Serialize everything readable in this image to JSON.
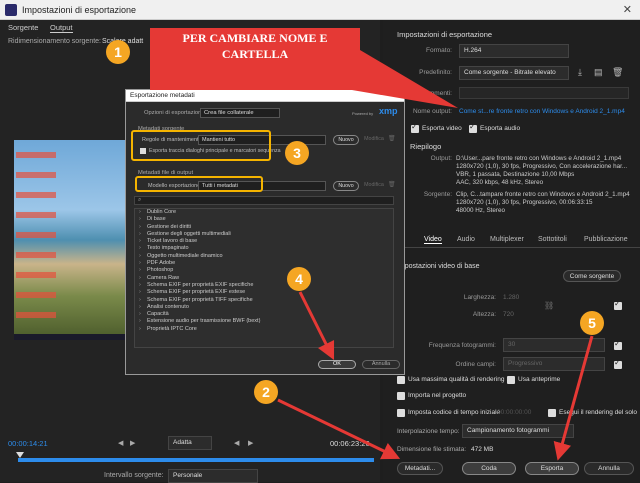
{
  "window": {
    "title": "Impostazioni di esportazione",
    "close": "✕"
  },
  "left_tabs": {
    "source": "Sorgente",
    "output": "Output",
    "resize_label": "Ridimensionamento sorgente:",
    "resize_value": "Scalare adatt"
  },
  "callout": {
    "text": "PER CAMBIARE NOME E CARTELLA",
    "color": "#e53935"
  },
  "steps": [
    "1",
    "2",
    "3",
    "4",
    "5"
  ],
  "dialog": {
    "title": "Esportazione metadati",
    "options_label": "Opzioni di esportazione:",
    "options_value": "Crea file collaterale",
    "powered": "Powered by",
    "xmp": "xmp",
    "source_meta_title": "Metadati sorgente",
    "retain_label": "Regole di mantenimento:",
    "retain_value": "Mantieni tutto",
    "new_btn": "Nuovo",
    "edit_btn": "Modifica",
    "sequence_check": "Esporta traccia dialoghi principale e marcatori sequenza",
    "output_meta_title": "Metadati file di output",
    "template_label": "Modello esportazione:",
    "template_value": "Tutti i metadati",
    "list": [
      "Dublin Core",
      "Di base",
      "Gestione dei diritti",
      "Gestione degli oggetti multimediali",
      "Ticket lavoro di base",
      "Testo impaginato",
      "Oggetto multimediale dinamico",
      "PDF Adobe",
      "Photoshop",
      "Camera Raw",
      "Schema EXIF per proprietà EXIF specifiche",
      "Schema EXIF per proprietà EXIF estese",
      "Schema EXIF per proprietà TIFF specifiche",
      "Analisi contenuto",
      "Capacità",
      "Estensione audio per trasmissione BWF (bext)",
      "Proprietà IPTC Core"
    ],
    "ok": "OK",
    "cancel": "Annulla"
  },
  "timeline": {
    "start": "00:00:14:21",
    "fit": "Adatta",
    "end": "00:06:23:26",
    "range_label": "Intervallo sorgente:",
    "range_value": "Personale"
  },
  "right": {
    "section": "Impostazioni di esportazione",
    "format_label": "Formato:",
    "format_value": "H.264",
    "preset_label": "Predefinito:",
    "preset_value": "Come sorgente - Bitrate elevato",
    "comments_label": "Commenti:",
    "output_name_label": "Nome output:",
    "output_name_value": "Come st...re fronte retro con Windows e Android 2_1.mp4",
    "export_video": "Esporta video",
    "export_audio": "Esporta audio",
    "summary": "Riepilogo",
    "output_label": "Output:",
    "output_lines": [
      "D:\\User...pare fronte retro con Windows e Android 2_1.mp4",
      "1280x720 (1,0), 30 fps, Progressivo, Con accelerazione har...",
      "VBR, 1 passata, Destinazione 10,00 Mbps",
      "AAC, 320 kbps, 48 kHz, Stereo"
    ],
    "source_label": "Sorgente:",
    "source_lines": [
      "Clip, C...tampare fronte retro con Windows e Android 2_1.mp4",
      "1280x720 (1,0), 30 fps, Progressivo, 00:06:33:15",
      "48000 Hz, Stereo"
    ],
    "tabs": [
      "Video",
      "Audio",
      "Multiplexer",
      "Sottotitoli",
      "Pubblicazione"
    ],
    "basic_video": "Impostazioni video di base",
    "match_source": "Come sorgente",
    "width_label": "Larghezza:",
    "width_value": "1.280",
    "height_label": "Altezza:",
    "height_value": "720",
    "fps_label": "Frequenza fotogrammi:",
    "fps_value": "30",
    "field_label": "Ordine campi:",
    "field_value": "Progressivo",
    "max_quality": "Usa massima qualità di rendering",
    "use_preview": "Usa anteprime",
    "import_project": "Importa nel progetto",
    "timecode": "Imposta codice di tempo iniziale",
    "timecode_value": "00:00:00:00",
    "alpha_only": "Esegui il rendering del solo cana",
    "interp_label": "Interpolazione tempo:",
    "interp_value": "Campionamento fotogrammi",
    "filesize_label": "Dimensione file stimata:",
    "filesize_value": "472 MB",
    "metadata_btn": "Metadati...",
    "queue_btn": "Coda",
    "export_btn": "Esporta",
    "cancel_btn": "Annulla"
  }
}
